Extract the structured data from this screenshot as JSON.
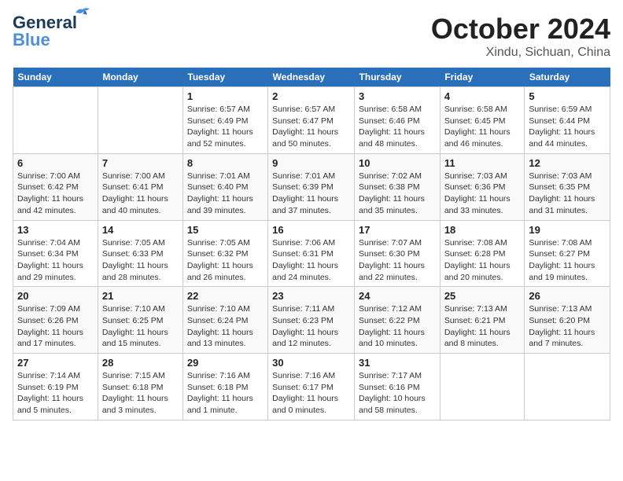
{
  "logo": {
    "line1": "General",
    "line2": "Blue"
  },
  "title": "October 2024",
  "location": "Xindu, Sichuan, China",
  "weekdays": [
    "Sunday",
    "Monday",
    "Tuesday",
    "Wednesday",
    "Thursday",
    "Friday",
    "Saturday"
  ],
  "weeks": [
    [
      {
        "day": "",
        "sunrise": "",
        "sunset": "",
        "daylight": ""
      },
      {
        "day": "",
        "sunrise": "",
        "sunset": "",
        "daylight": ""
      },
      {
        "day": "1",
        "sunrise": "Sunrise: 6:57 AM",
        "sunset": "Sunset: 6:49 PM",
        "daylight": "Daylight: 11 hours and 52 minutes."
      },
      {
        "day": "2",
        "sunrise": "Sunrise: 6:57 AM",
        "sunset": "Sunset: 6:47 PM",
        "daylight": "Daylight: 11 hours and 50 minutes."
      },
      {
        "day": "3",
        "sunrise": "Sunrise: 6:58 AM",
        "sunset": "Sunset: 6:46 PM",
        "daylight": "Daylight: 11 hours and 48 minutes."
      },
      {
        "day": "4",
        "sunrise": "Sunrise: 6:58 AM",
        "sunset": "Sunset: 6:45 PM",
        "daylight": "Daylight: 11 hours and 46 minutes."
      },
      {
        "day": "5",
        "sunrise": "Sunrise: 6:59 AM",
        "sunset": "Sunset: 6:44 PM",
        "daylight": "Daylight: 11 hours and 44 minutes."
      }
    ],
    [
      {
        "day": "6",
        "sunrise": "Sunrise: 7:00 AM",
        "sunset": "Sunset: 6:42 PM",
        "daylight": "Daylight: 11 hours and 42 minutes."
      },
      {
        "day": "7",
        "sunrise": "Sunrise: 7:00 AM",
        "sunset": "Sunset: 6:41 PM",
        "daylight": "Daylight: 11 hours and 40 minutes."
      },
      {
        "day": "8",
        "sunrise": "Sunrise: 7:01 AM",
        "sunset": "Sunset: 6:40 PM",
        "daylight": "Daylight: 11 hours and 39 minutes."
      },
      {
        "day": "9",
        "sunrise": "Sunrise: 7:01 AM",
        "sunset": "Sunset: 6:39 PM",
        "daylight": "Daylight: 11 hours and 37 minutes."
      },
      {
        "day": "10",
        "sunrise": "Sunrise: 7:02 AM",
        "sunset": "Sunset: 6:38 PM",
        "daylight": "Daylight: 11 hours and 35 minutes."
      },
      {
        "day": "11",
        "sunrise": "Sunrise: 7:03 AM",
        "sunset": "Sunset: 6:36 PM",
        "daylight": "Daylight: 11 hours and 33 minutes."
      },
      {
        "day": "12",
        "sunrise": "Sunrise: 7:03 AM",
        "sunset": "Sunset: 6:35 PM",
        "daylight": "Daylight: 11 hours and 31 minutes."
      }
    ],
    [
      {
        "day": "13",
        "sunrise": "Sunrise: 7:04 AM",
        "sunset": "Sunset: 6:34 PM",
        "daylight": "Daylight: 11 hours and 29 minutes."
      },
      {
        "day": "14",
        "sunrise": "Sunrise: 7:05 AM",
        "sunset": "Sunset: 6:33 PM",
        "daylight": "Daylight: 11 hours and 28 minutes."
      },
      {
        "day": "15",
        "sunrise": "Sunrise: 7:05 AM",
        "sunset": "Sunset: 6:32 PM",
        "daylight": "Daylight: 11 hours and 26 minutes."
      },
      {
        "day": "16",
        "sunrise": "Sunrise: 7:06 AM",
        "sunset": "Sunset: 6:31 PM",
        "daylight": "Daylight: 11 hours and 24 minutes."
      },
      {
        "day": "17",
        "sunrise": "Sunrise: 7:07 AM",
        "sunset": "Sunset: 6:30 PM",
        "daylight": "Daylight: 11 hours and 22 minutes."
      },
      {
        "day": "18",
        "sunrise": "Sunrise: 7:08 AM",
        "sunset": "Sunset: 6:28 PM",
        "daylight": "Daylight: 11 hours and 20 minutes."
      },
      {
        "day": "19",
        "sunrise": "Sunrise: 7:08 AM",
        "sunset": "Sunset: 6:27 PM",
        "daylight": "Daylight: 11 hours and 19 minutes."
      }
    ],
    [
      {
        "day": "20",
        "sunrise": "Sunrise: 7:09 AM",
        "sunset": "Sunset: 6:26 PM",
        "daylight": "Daylight: 11 hours and 17 minutes."
      },
      {
        "day": "21",
        "sunrise": "Sunrise: 7:10 AM",
        "sunset": "Sunset: 6:25 PM",
        "daylight": "Daylight: 11 hours and 15 minutes."
      },
      {
        "day": "22",
        "sunrise": "Sunrise: 7:10 AM",
        "sunset": "Sunset: 6:24 PM",
        "daylight": "Daylight: 11 hours and 13 minutes."
      },
      {
        "day": "23",
        "sunrise": "Sunrise: 7:11 AM",
        "sunset": "Sunset: 6:23 PM",
        "daylight": "Daylight: 11 hours and 12 minutes."
      },
      {
        "day": "24",
        "sunrise": "Sunrise: 7:12 AM",
        "sunset": "Sunset: 6:22 PM",
        "daylight": "Daylight: 11 hours and 10 minutes."
      },
      {
        "day": "25",
        "sunrise": "Sunrise: 7:13 AM",
        "sunset": "Sunset: 6:21 PM",
        "daylight": "Daylight: 11 hours and 8 minutes."
      },
      {
        "day": "26",
        "sunrise": "Sunrise: 7:13 AM",
        "sunset": "Sunset: 6:20 PM",
        "daylight": "Daylight: 11 hours and 7 minutes."
      }
    ],
    [
      {
        "day": "27",
        "sunrise": "Sunrise: 7:14 AM",
        "sunset": "Sunset: 6:19 PM",
        "daylight": "Daylight: 11 hours and 5 minutes."
      },
      {
        "day": "28",
        "sunrise": "Sunrise: 7:15 AM",
        "sunset": "Sunset: 6:18 PM",
        "daylight": "Daylight: 11 hours and 3 minutes."
      },
      {
        "day": "29",
        "sunrise": "Sunrise: 7:16 AM",
        "sunset": "Sunset: 6:18 PM",
        "daylight": "Daylight: 11 hours and 1 minute."
      },
      {
        "day": "30",
        "sunrise": "Sunrise: 7:16 AM",
        "sunset": "Sunset: 6:17 PM",
        "daylight": "Daylight: 11 hours and 0 minutes."
      },
      {
        "day": "31",
        "sunrise": "Sunrise: 7:17 AM",
        "sunset": "Sunset: 6:16 PM",
        "daylight": "Daylight: 10 hours and 58 minutes."
      },
      {
        "day": "",
        "sunrise": "",
        "sunset": "",
        "daylight": ""
      },
      {
        "day": "",
        "sunrise": "",
        "sunset": "",
        "daylight": ""
      }
    ]
  ]
}
